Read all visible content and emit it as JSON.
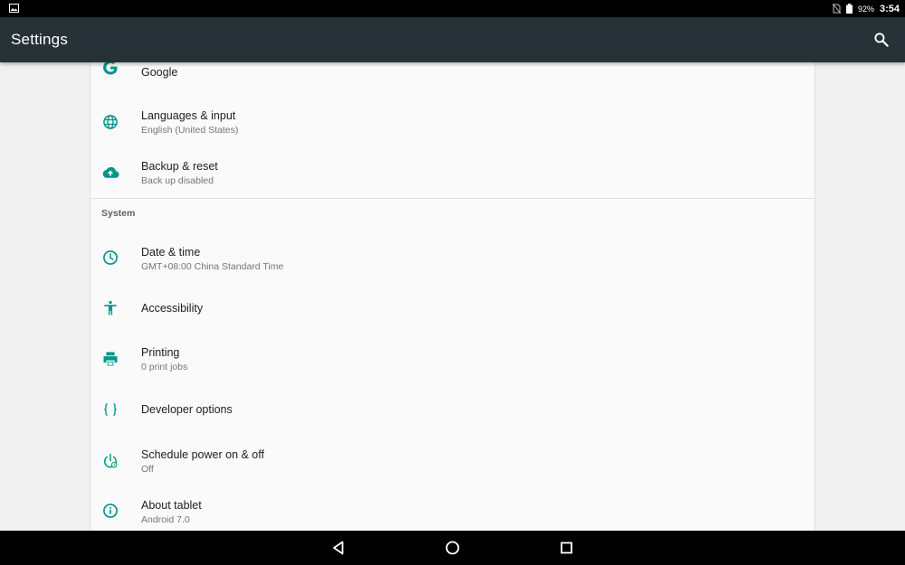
{
  "status_bar": {
    "notification_icon": "image-icon",
    "no-sim-icon": "no-sim-icon",
    "battery_icon": "battery-icon",
    "battery_percent": "92%",
    "time": "3:54"
  },
  "app_bar": {
    "title": "Settings",
    "search_icon": "search-icon"
  },
  "items": [
    {
      "title": "Google",
      "subtitle": "",
      "icon": "google-icon"
    },
    {
      "title": "Languages & input",
      "subtitle": "English (United States)",
      "icon": "globe-icon"
    },
    {
      "title": "Backup & reset",
      "subtitle": "Back up disabled",
      "icon": "cloud-upload-icon"
    }
  ],
  "system_section": {
    "header": "System",
    "items": [
      {
        "title": "Date & time",
        "subtitle": "GMT+08:00 China Standard Time",
        "icon": "clock-icon"
      },
      {
        "title": "Accessibility",
        "subtitle": "",
        "icon": "accessibility-icon"
      },
      {
        "title": "Printing",
        "subtitle": "0 print jobs",
        "icon": "printer-icon"
      },
      {
        "title": "Developer options",
        "subtitle": "",
        "icon": "braces-icon"
      },
      {
        "title": "Schedule power on & off",
        "subtitle": "Off",
        "icon": "power-schedule-icon"
      },
      {
        "title": "About tablet",
        "subtitle": "Android 7.0",
        "icon": "info-icon"
      }
    ]
  },
  "nav_bar": {
    "back": "back-icon",
    "home": "home-icon",
    "recents": "recents-icon"
  },
  "colors": {
    "accent": "#009688",
    "app_bar": "#263238",
    "status_bar": "#000000"
  }
}
